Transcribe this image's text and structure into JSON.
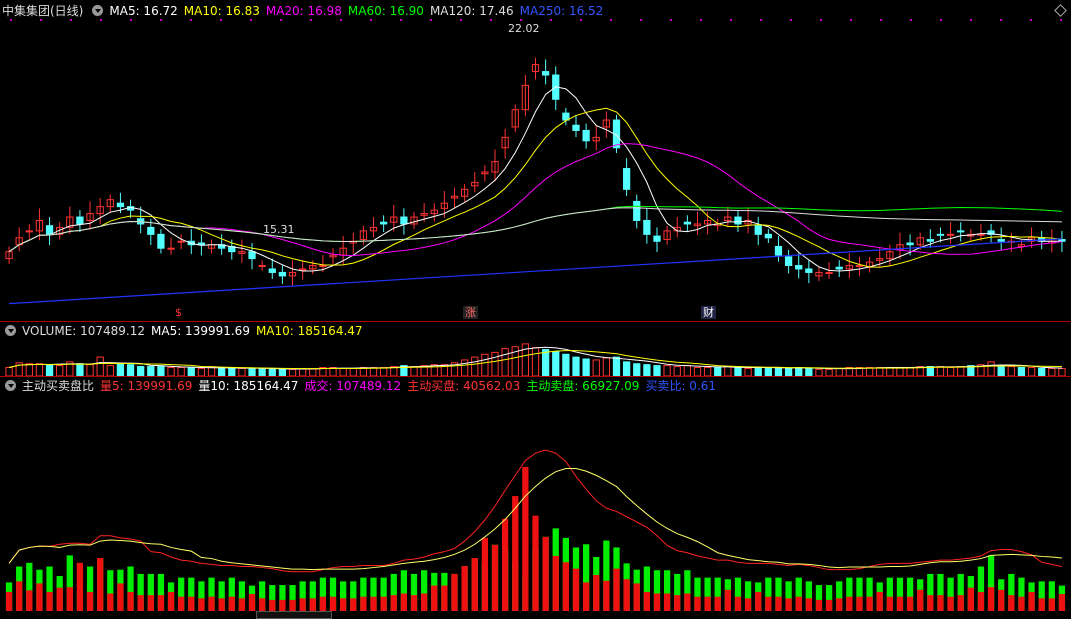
{
  "main_panel": {
    "title": "中集集团(日线)",
    "ma_items": [
      {
        "label": "MA5: 16.72",
        "color": "#ffffff"
      },
      {
        "label": "MA10: 16.83",
        "color": "#ffff00"
      },
      {
        "label": "MA20: 16.98",
        "color": "#ff00ff"
      },
      {
        "label": "MA60: 16.90",
        "color": "#00ff00"
      },
      {
        "label": "MA120: 17.46",
        "color": "#dddddd"
      },
      {
        "label": "MA250: 16.52",
        "color": "#3355ff"
      }
    ],
    "high_label": "22.02",
    "low_label": "15.31",
    "events": [
      {
        "label": "$",
        "color": "#ff3333"
      },
      {
        "label": "涨",
        "color": "#ff6666"
      },
      {
        "label": "财",
        "color": "#ffffff"
      }
    ]
  },
  "volume_panel": {
    "label": "VOLUME: 107489.12",
    "ma5": "MA5: 139991.69",
    "ma10": "MA10: 185164.47"
  },
  "ratio_panel": {
    "title": "主动买卖盘比",
    "items": [
      {
        "label": "量5: 139991.69",
        "color": "#ff3333"
      },
      {
        "label": "量10: 185164.47",
        "color": "#ffffff"
      },
      {
        "label": "成交: 107489.12",
        "color": "#ff00ff"
      },
      {
        "label": "主动买盘: 40562.03",
        "color": "#ff3333"
      },
      {
        "label": "主动卖盘: 66927.09",
        "color": "#00ff00"
      },
      {
        "label": "买卖比: 0.61",
        "color": "#3355ff"
      }
    ]
  },
  "chart_data": {
    "type": "candlestick",
    "ylim": [
      14.5,
      22.7
    ],
    "close": [
      16.3,
      16.7,
      16.9,
      17.2,
      16.8,
      17.0,
      17.3,
      17.1,
      17.4,
      17.6,
      17.8,
      17.6,
      17.5,
      17.1,
      16.8,
      16.4,
      16.4,
      16.6,
      16.5,
      16.5,
      16.5,
      16.4,
      16.3,
      16.3,
      16.1,
      15.9,
      15.7,
      15.6,
      15.7,
      15.8,
      15.9,
      15.9,
      16.2,
      16.4,
      16.6,
      16.9,
      17.0,
      17.1,
      17.3,
      17.1,
      17.3,
      17.4,
      17.5,
      17.7,
      17.9,
      18.1,
      18.3,
      18.6,
      18.9,
      19.6,
      20.4,
      21.1,
      21.7,
      21.4,
      20.7,
      20.1,
      19.8,
      19.5,
      19.6,
      20.1,
      19.3,
      18.1,
      17.2,
      16.8,
      16.6,
      16.9,
      17.0,
      17.1,
      17.1,
      17.2,
      17.1,
      17.3,
      17.1,
      17.2,
      16.8,
      16.7,
      16.2,
      15.9,
      15.8,
      15.7,
      15.7,
      15.7,
      15.8,
      15.9,
      15.9,
      16.0,
      16.1,
      16.3,
      16.5,
      16.5,
      16.7,
      16.6,
      16.8,
      16.8,
      16.9,
      16.8,
      16.8,
      16.8,
      16.6,
      16.6,
      16.5,
      16.7,
      16.6,
      16.6,
      16.6
    ],
    "volume": [
      0.9,
      1.4,
      1.3,
      1.3,
      1.2,
      1.1,
      1.5,
      1.3,
      1.2,
      2.0,
      1.1,
      1.3,
      1.2,
      1.0,
      1.0,
      1.0,
      0.9,
      0.9,
      0.9,
      0.8,
      0.9,
      0.8,
      0.9,
      0.8,
      0.8,
      0.8,
      0.7,
      0.7,
      0.7,
      0.8,
      0.8,
      0.9,
      0.9,
      0.8,
      0.8,
      0.9,
      0.9,
      0.9,
      1.0,
      1.1,
      1.0,
      1.1,
      1.2,
      1.2,
      1.4,
      1.7,
      2.0,
      2.3,
      2.5,
      2.9,
      3.1,
      3.4,
      3.0,
      2.8,
      2.6,
      2.3,
      2.0,
      1.8,
      1.7,
      1.9,
      2.0,
      1.5,
      1.3,
      1.2,
      1.1,
      1.1,
      1.0,
      1.1,
      0.9,
      0.9,
      0.9,
      1.0,
      0.9,
      0.8,
      0.9,
      0.9,
      0.9,
      0.8,
      0.9,
      0.8,
      0.7,
      0.7,
      0.8,
      0.9,
      0.9,
      0.9,
      0.9,
      0.9,
      0.9,
      0.9,
      1.0,
      1.0,
      1.0,
      0.9,
      1.0,
      1.1,
      1.2,
      1.5,
      1.0,
      1.0,
      0.9,
      0.9,
      0.8,
      0.8,
      0.8
    ],
    "buy_ratio": [
      0.4,
      0.4,
      0.3,
      0.4,
      0.3,
      0.4,
      0.3,
      0.7,
      0.3,
      0.5,
      0.3,
      0.4,
      0.3,
      0.3,
      0.3,
      0.3,
      0.4,
      0.3,
      0.3,
      0.3,
      0.3,
      0.3,
      0.3,
      0.3,
      0.4,
      0.3,
      0.3,
      0.3,
      0.3,
      0.3,
      0.3,
      0.3,
      0.3,
      0.3,
      0.3,
      0.3,
      0.3,
      0.3,
      0.3,
      0.3,
      0.3,
      0.3,
      0.4,
      0.4,
      0.5,
      0.5,
      0.5,
      0.6,
      0.5,
      0.6,
      0.7,
      0.8,
      0.6,
      0.5,
      0.4,
      0.4,
      0.4,
      0.3,
      0.4,
      0.3,
      0.4,
      0.4,
      0.4,
      0.3,
      0.3,
      0.3,
      0.3,
      0.3,
      0.3,
      0.3,
      0.3,
      0.4,
      0.3,
      0.3,
      0.4,
      0.3,
      0.3,
      0.3,
      0.3,
      0.3,
      0.3,
      0.3,
      0.3,
      0.3,
      0.3,
      0.3,
      0.4,
      0.3,
      0.3,
      0.3,
      0.4,
      0.3,
      0.3,
      0.3,
      0.3,
      0.4,
      0.3,
      0.3,
      0.4,
      0.3,
      0.3,
      0.4,
      0.3,
      0.3,
      0.4
    ]
  }
}
